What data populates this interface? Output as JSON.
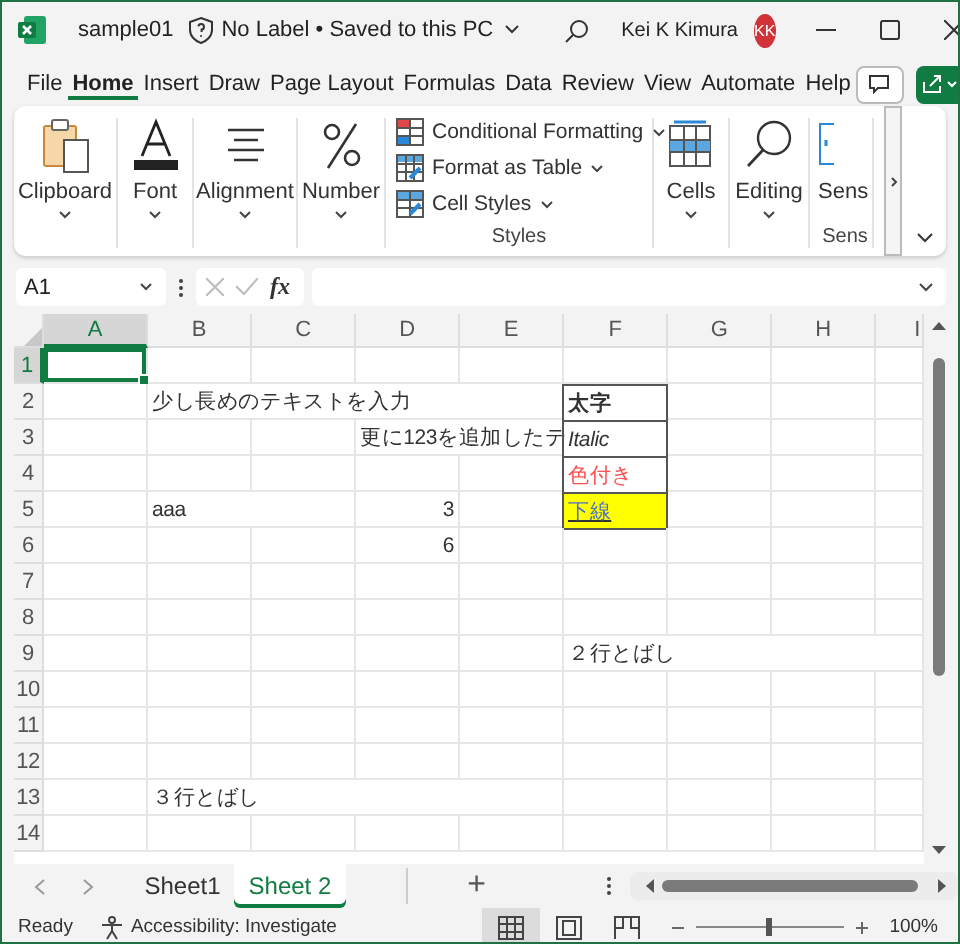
{
  "window": {
    "file_name": "sample01",
    "save_status": "No Label • Saved to this PC",
    "user_name": "Kei K Kimura",
    "user_initials": "KK"
  },
  "menu_tabs": [
    {
      "label": "File",
      "selected": false
    },
    {
      "label": "Home",
      "selected": true
    },
    {
      "label": "Insert",
      "selected": false
    },
    {
      "label": "Draw",
      "selected": false
    },
    {
      "label": "Page Layout",
      "selected": false
    },
    {
      "label": "Formulas",
      "selected": false
    },
    {
      "label": "Data",
      "selected": false
    },
    {
      "label": "Review",
      "selected": false
    },
    {
      "label": "View",
      "selected": false
    },
    {
      "label": "Automate",
      "selected": false
    },
    {
      "label": "Help",
      "selected": false
    }
  ],
  "ribbon": {
    "groups": [
      {
        "kind": "button",
        "label": "Clipboard"
      },
      {
        "kind": "button",
        "label": "Font"
      },
      {
        "kind": "button",
        "label": "Alignment"
      },
      {
        "kind": "button",
        "label": "Number"
      },
      {
        "kind": "list",
        "label": "Styles",
        "items": [
          "Conditional Formatting",
          "Format as Table",
          "Cell Styles"
        ]
      },
      {
        "kind": "button",
        "label": "Cells"
      },
      {
        "kind": "button",
        "label": "Editing"
      },
      {
        "kind": "cut",
        "label": "Sens",
        "group_label": "Sens"
      }
    ]
  },
  "formula_bar": {
    "name_box": "A1",
    "function_label": "fx"
  },
  "grid": {
    "columns": [
      {
        "label": "A",
        "selected": true
      },
      {
        "label": "B",
        "selected": false
      },
      {
        "label": "C",
        "selected": false
      },
      {
        "label": "D",
        "selected": false
      },
      {
        "label": "E",
        "selected": false
      },
      {
        "label": "F",
        "selected": false
      },
      {
        "label": "G",
        "selected": false
      },
      {
        "label": "H",
        "selected": false
      },
      {
        "label": "I",
        "selected": false
      }
    ],
    "rows": [
      {
        "label": "1",
        "selected": true
      },
      {
        "label": "2",
        "selected": false,
        "cells": [
          null,
          {
            "text": "少し長めのテキストを入力",
            "kind": "text",
            "bold": false,
            "italic": false,
            "underline": false,
            "bordered": false
          },
          null,
          null,
          null,
          {
            "text": "太字",
            "kind": "text",
            "bold": true,
            "italic": false,
            "underline": false,
            "bordered": true
          }
        ]
      },
      {
        "label": "3",
        "selected": false,
        "cells": [
          null,
          null,
          null,
          {
            "text": "更に123を追加したテ",
            "kind": "text",
            "bold": false,
            "italic": false,
            "underline": false,
            "bordered": false
          },
          null,
          {
            "text": "Italic",
            "kind": "text",
            "bold": false,
            "italic": true,
            "underline": false,
            "bordered": true
          }
        ]
      },
      {
        "label": "4",
        "selected": false,
        "cells": [
          null,
          null,
          null,
          null,
          null,
          {
            "text": "色付き",
            "kind": "text",
            "bold": false,
            "italic": false,
            "underline": false,
            "bordered": true,
            "color": "#ff5050"
          }
        ]
      },
      {
        "label": "5",
        "selected": false,
        "cells": [
          null,
          {
            "text": "aaa",
            "kind": "text",
            "bold": false,
            "italic": false,
            "underline": false,
            "bordered": false
          },
          null,
          {
            "text": "3",
            "kind": "number",
            "bold": false,
            "italic": false,
            "underline": false,
            "bordered": false
          },
          null,
          {
            "text": "下線",
            "kind": "text",
            "bold": false,
            "italic": false,
            "underline": true,
            "bordered": true,
            "highlighted": true,
            "color": "#4a6fd0"
          }
        ]
      },
      {
        "label": "6",
        "selected": false,
        "cells": [
          null,
          null,
          null,
          {
            "text": "6",
            "kind": "number",
            "bold": false,
            "italic": false,
            "underline": false,
            "bordered": false
          }
        ]
      },
      {
        "label": "7",
        "selected": false
      },
      {
        "label": "8",
        "selected": false
      },
      {
        "label": "9",
        "selected": false,
        "cells": [
          null,
          null,
          null,
          null,
          null,
          {
            "text": "２行とばし",
            "kind": "text",
            "bold": false,
            "italic": false,
            "underline": false,
            "bordered": false
          }
        ]
      },
      {
        "label": "10",
        "selected": false
      },
      {
        "label": "11",
        "selected": false
      },
      {
        "label": "12",
        "selected": false
      },
      {
        "label": "13",
        "selected": false,
        "cells": [
          null,
          {
            "text": "３行とばし",
            "kind": "text",
            "bold": false,
            "italic": false,
            "underline": false,
            "bordered": false
          }
        ]
      },
      {
        "label": "14",
        "selected": false
      }
    ]
  },
  "sheet_tabs": [
    {
      "label": "Sheet1",
      "selected": false
    },
    {
      "label": "Sheet 2",
      "selected": true
    }
  ],
  "add_sheet_label": "+",
  "status_bar": {
    "status": "Ready",
    "accessibility": "Accessibility: Investigate",
    "views": [
      {
        "kind": "normal",
        "selected": true
      },
      {
        "kind": "page_layout",
        "selected": false
      },
      {
        "kind": "page_break",
        "selected": false
      }
    ],
    "zoom": {
      "level": 0.5,
      "reading": "100%"
    }
  }
}
